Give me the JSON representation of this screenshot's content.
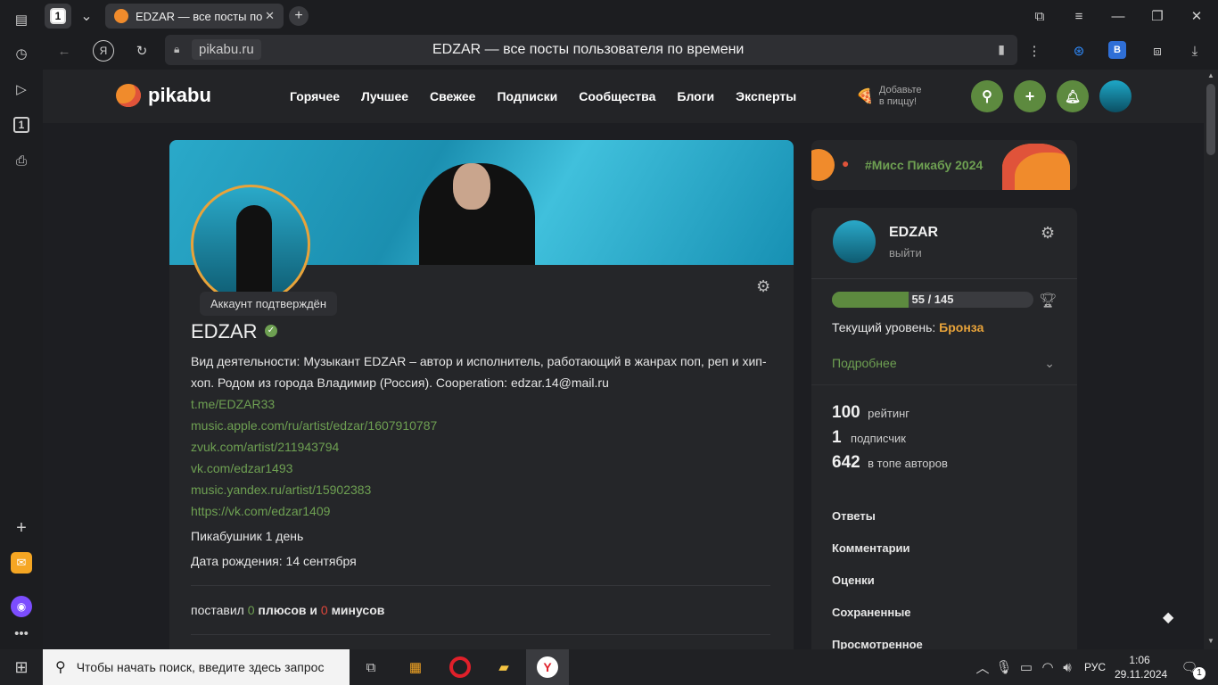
{
  "browser": {
    "tab_count": "1",
    "tab_title": "EDZAR — все посты по",
    "domain": "pikabu.ru",
    "page_title": "EDZAR — все посты пользователя по времени"
  },
  "site": {
    "logo_text": "pikabu",
    "nav": [
      "Горячее",
      "Лучшее",
      "Свежее",
      "Подписки",
      "Сообщества",
      "Блоги",
      "Эксперты"
    ],
    "promo_line1": "Добавьте",
    "promo_line2": "в пиццу!"
  },
  "profile": {
    "verified_tooltip": "Аккаунт подтверждён",
    "username": "EDZAR",
    "bio_line1": "Вид деятельности: Музыкант EDZAR – автор и исполнитель, работающий в жанрах поп, реп и хип-",
    "bio_line2": "хоп. Родом из города Владимир (Россия). Cooperation: edzar.14@mail.ru",
    "links": [
      "t.me/EDZAR33",
      "music.apple.com/ru/artist/edzar/1607910787",
      "zvuk.com/artist/211943794",
      "vk.com/edzar1493",
      "music.yandex.ru/artist/15902383",
      "https://vk.com/edzar1409"
    ],
    "member_since": "Пикабушник 1 день",
    "birthday": "Дата рождения: 14 сентября",
    "votes_prefix": "поставил",
    "plus_count": "0",
    "plus_label": "плюсов и",
    "minus_count": "0",
    "minus_label": "минусов"
  },
  "sidebar": {
    "miss_banner": "#Мисс Пикабу 2024",
    "user_name": "EDZAR",
    "logout": "выйти",
    "progress_text": "55 / 145",
    "progress_fraction": 0.379,
    "level_label": "Текущий уровень:",
    "level_value": "Бронза",
    "details": "Подробнее",
    "stats": [
      {
        "value": "100",
        "label": "рейтинг"
      },
      {
        "value": "1",
        "label": "подписчик"
      },
      {
        "value": "642",
        "label": "в топе авторов"
      }
    ],
    "menu": [
      "Ответы",
      "Комментарии",
      "Оценки",
      "Сохраненные",
      "Просмотренное"
    ]
  },
  "taskbar": {
    "search_placeholder": "Чтобы начать поиск, введите здесь запрос",
    "lang": "РУС",
    "time": "1:06",
    "date": "29.11.2024",
    "notif_count": "1"
  },
  "colors": {
    "accent_green": "#6ea052",
    "bronze": "#e8a33a",
    "minus_red": "#e0473c"
  }
}
